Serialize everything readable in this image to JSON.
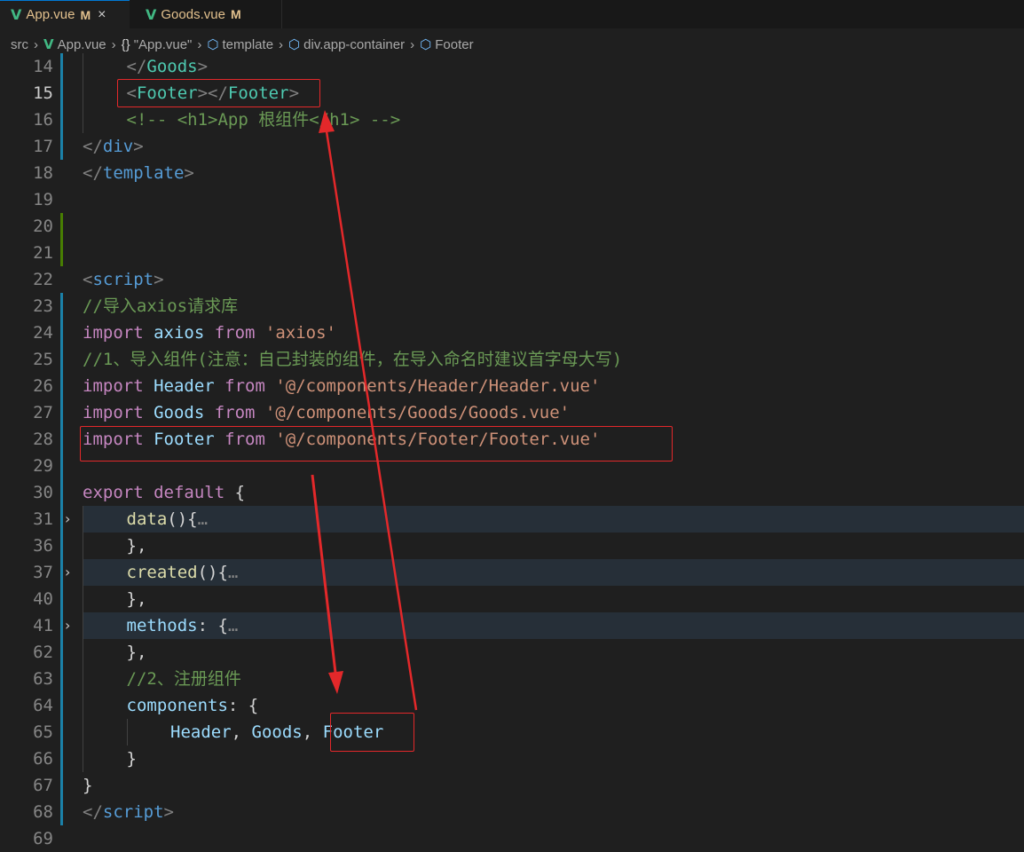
{
  "tabs": [
    {
      "label": "App.vue",
      "status": "M",
      "active": true
    },
    {
      "label": "Goods.vue",
      "status": "M",
      "active": false
    }
  ],
  "tab_close_glyph": "×",
  "breadcrumb": [
    "src",
    "App.vue",
    "\"App.vue\"",
    "template",
    "div.app-container",
    "Footer"
  ],
  "lines": [
    {
      "n": "14",
      "indent": 1,
      "segs": [
        [
          "c-tag",
          "</"
        ],
        [
          "c-comp",
          "Goods"
        ],
        [
          "c-tag",
          ">"
        ]
      ]
    },
    {
      "n": "15",
      "indent": 1,
      "current": true,
      "segs": [
        [
          "c-tag",
          "<"
        ],
        [
          "c-comp",
          "Footer"
        ],
        [
          "c-tag",
          "></"
        ],
        [
          "c-comp",
          "Footer"
        ],
        [
          "c-tag",
          ">"
        ]
      ]
    },
    {
      "n": "16",
      "indent": 1,
      "segs": [
        [
          "c-com",
          "<!-- <h1>App 根组件</h1> -->"
        ]
      ]
    },
    {
      "n": "17",
      "indent": 0,
      "segs": [
        [
          "c-tag",
          "</"
        ],
        [
          "c-el",
          "div"
        ],
        [
          "c-tag",
          ">"
        ]
      ]
    },
    {
      "n": "18",
      "indent": 0,
      "segs": [
        [
          "c-tag",
          "</"
        ],
        [
          "c-el",
          "template"
        ],
        [
          "c-tag",
          ">"
        ]
      ]
    },
    {
      "n": "19",
      "indent": 0,
      "segs": []
    },
    {
      "n": "20",
      "indent": 0,
      "segs": []
    },
    {
      "n": "21",
      "indent": 0,
      "segs": []
    },
    {
      "n": "22",
      "indent": 0,
      "segs": [
        [
          "c-tag",
          "<"
        ],
        [
          "c-el",
          "script"
        ],
        [
          "c-tag",
          ">"
        ]
      ]
    },
    {
      "n": "23",
      "indent": 0,
      "segs": [
        [
          "c-com",
          "//导入axios请求库"
        ]
      ]
    },
    {
      "n": "24",
      "indent": 0,
      "segs": [
        [
          "c-kw",
          "import "
        ],
        [
          "c-var",
          "axios "
        ],
        [
          "c-kw",
          "from "
        ],
        [
          "c-str",
          "'axios'"
        ]
      ]
    },
    {
      "n": "25",
      "indent": 0,
      "segs": [
        [
          "c-com",
          "//1、导入组件(注意：自己封装的组件，在导入命名时建议首字母大写)"
        ]
      ]
    },
    {
      "n": "26",
      "indent": 0,
      "segs": [
        [
          "c-kw",
          "import "
        ],
        [
          "c-var",
          "Header "
        ],
        [
          "c-kw",
          "from "
        ],
        [
          "c-str",
          "'@/components/Header/Header.vue'"
        ]
      ]
    },
    {
      "n": "27",
      "indent": 0,
      "segs": [
        [
          "c-kw",
          "import "
        ],
        [
          "c-var",
          "Goods "
        ],
        [
          "c-kw",
          "from "
        ],
        [
          "c-str",
          "'@/components/Goods/Goods.vue'"
        ]
      ]
    },
    {
      "n": "28",
      "indent": 0,
      "segs": [
        [
          "c-kw",
          "import "
        ],
        [
          "c-var",
          "Footer "
        ],
        [
          "c-kw",
          "from "
        ],
        [
          "c-str",
          "'@/components/Footer/Footer.vue'"
        ]
      ]
    },
    {
      "n": "29",
      "indent": 0,
      "segs": []
    },
    {
      "n": "30",
      "indent": 0,
      "segs": [
        [
          "c-kw",
          "export "
        ],
        [
          "c-kw",
          "default "
        ],
        [
          "c-def",
          "{"
        ]
      ]
    },
    {
      "n": "31",
      "indent": 1,
      "folded": true,
      "segs": [
        [
          "c-fn",
          "data"
        ],
        [
          "c-def",
          "(){"
        ],
        [
          "c-dots",
          "…"
        ]
      ]
    },
    {
      "n": "36",
      "indent": 1,
      "segs": [
        [
          "c-def",
          "},"
        ]
      ]
    },
    {
      "n": "37",
      "indent": 1,
      "folded": true,
      "segs": [
        [
          "c-fn",
          "created"
        ],
        [
          "c-def",
          "(){"
        ],
        [
          "c-dots",
          "…"
        ]
      ]
    },
    {
      "n": "40",
      "indent": 1,
      "segs": [
        [
          "c-def",
          "},"
        ]
      ]
    },
    {
      "n": "41",
      "indent": 1,
      "folded": true,
      "segs": [
        [
          "c-var",
          "methods"
        ],
        [
          "c-def",
          ": {"
        ],
        [
          "c-dots",
          "…"
        ]
      ]
    },
    {
      "n": "62",
      "indent": 1,
      "segs": [
        [
          "c-def",
          "},"
        ]
      ]
    },
    {
      "n": "63",
      "indent": 1,
      "segs": [
        [
          "c-com",
          "//2、注册组件"
        ]
      ]
    },
    {
      "n": "64",
      "indent": 1,
      "segs": [
        [
          "c-var",
          "components"
        ],
        [
          "c-def",
          ": {"
        ]
      ]
    },
    {
      "n": "65",
      "indent": 2,
      "segs": [
        [
          "c-var",
          "Header"
        ],
        [
          "c-def",
          ", "
        ],
        [
          "c-var",
          "Goods"
        ],
        [
          "c-def",
          ", "
        ],
        [
          "c-var",
          "Footer"
        ]
      ]
    },
    {
      "n": "66",
      "indent": 1,
      "segs": [
        [
          "c-def",
          "}"
        ]
      ]
    },
    {
      "n": "67",
      "indent": 0,
      "segs": [
        [
          "c-def",
          "}"
        ]
      ]
    },
    {
      "n": "68",
      "indent": 0,
      "segs": [
        [
          "c-tag",
          "</"
        ],
        [
          "c-el",
          "script"
        ],
        [
          "c-tag",
          ">"
        ]
      ]
    },
    {
      "n": "69",
      "indent": 0,
      "segs": []
    }
  ],
  "colors": {
    "background": "#1f1f1f",
    "tab_modified": "#e2c08d",
    "vue_icon": "#41b883",
    "annotation_red": "#e3282a",
    "gutter_modified": "#1b81a8",
    "gutter_added": "#487e02"
  },
  "icons": {
    "vue": "vue-icon",
    "object": "cube-icon",
    "fold": "chevron-right-icon"
  }
}
